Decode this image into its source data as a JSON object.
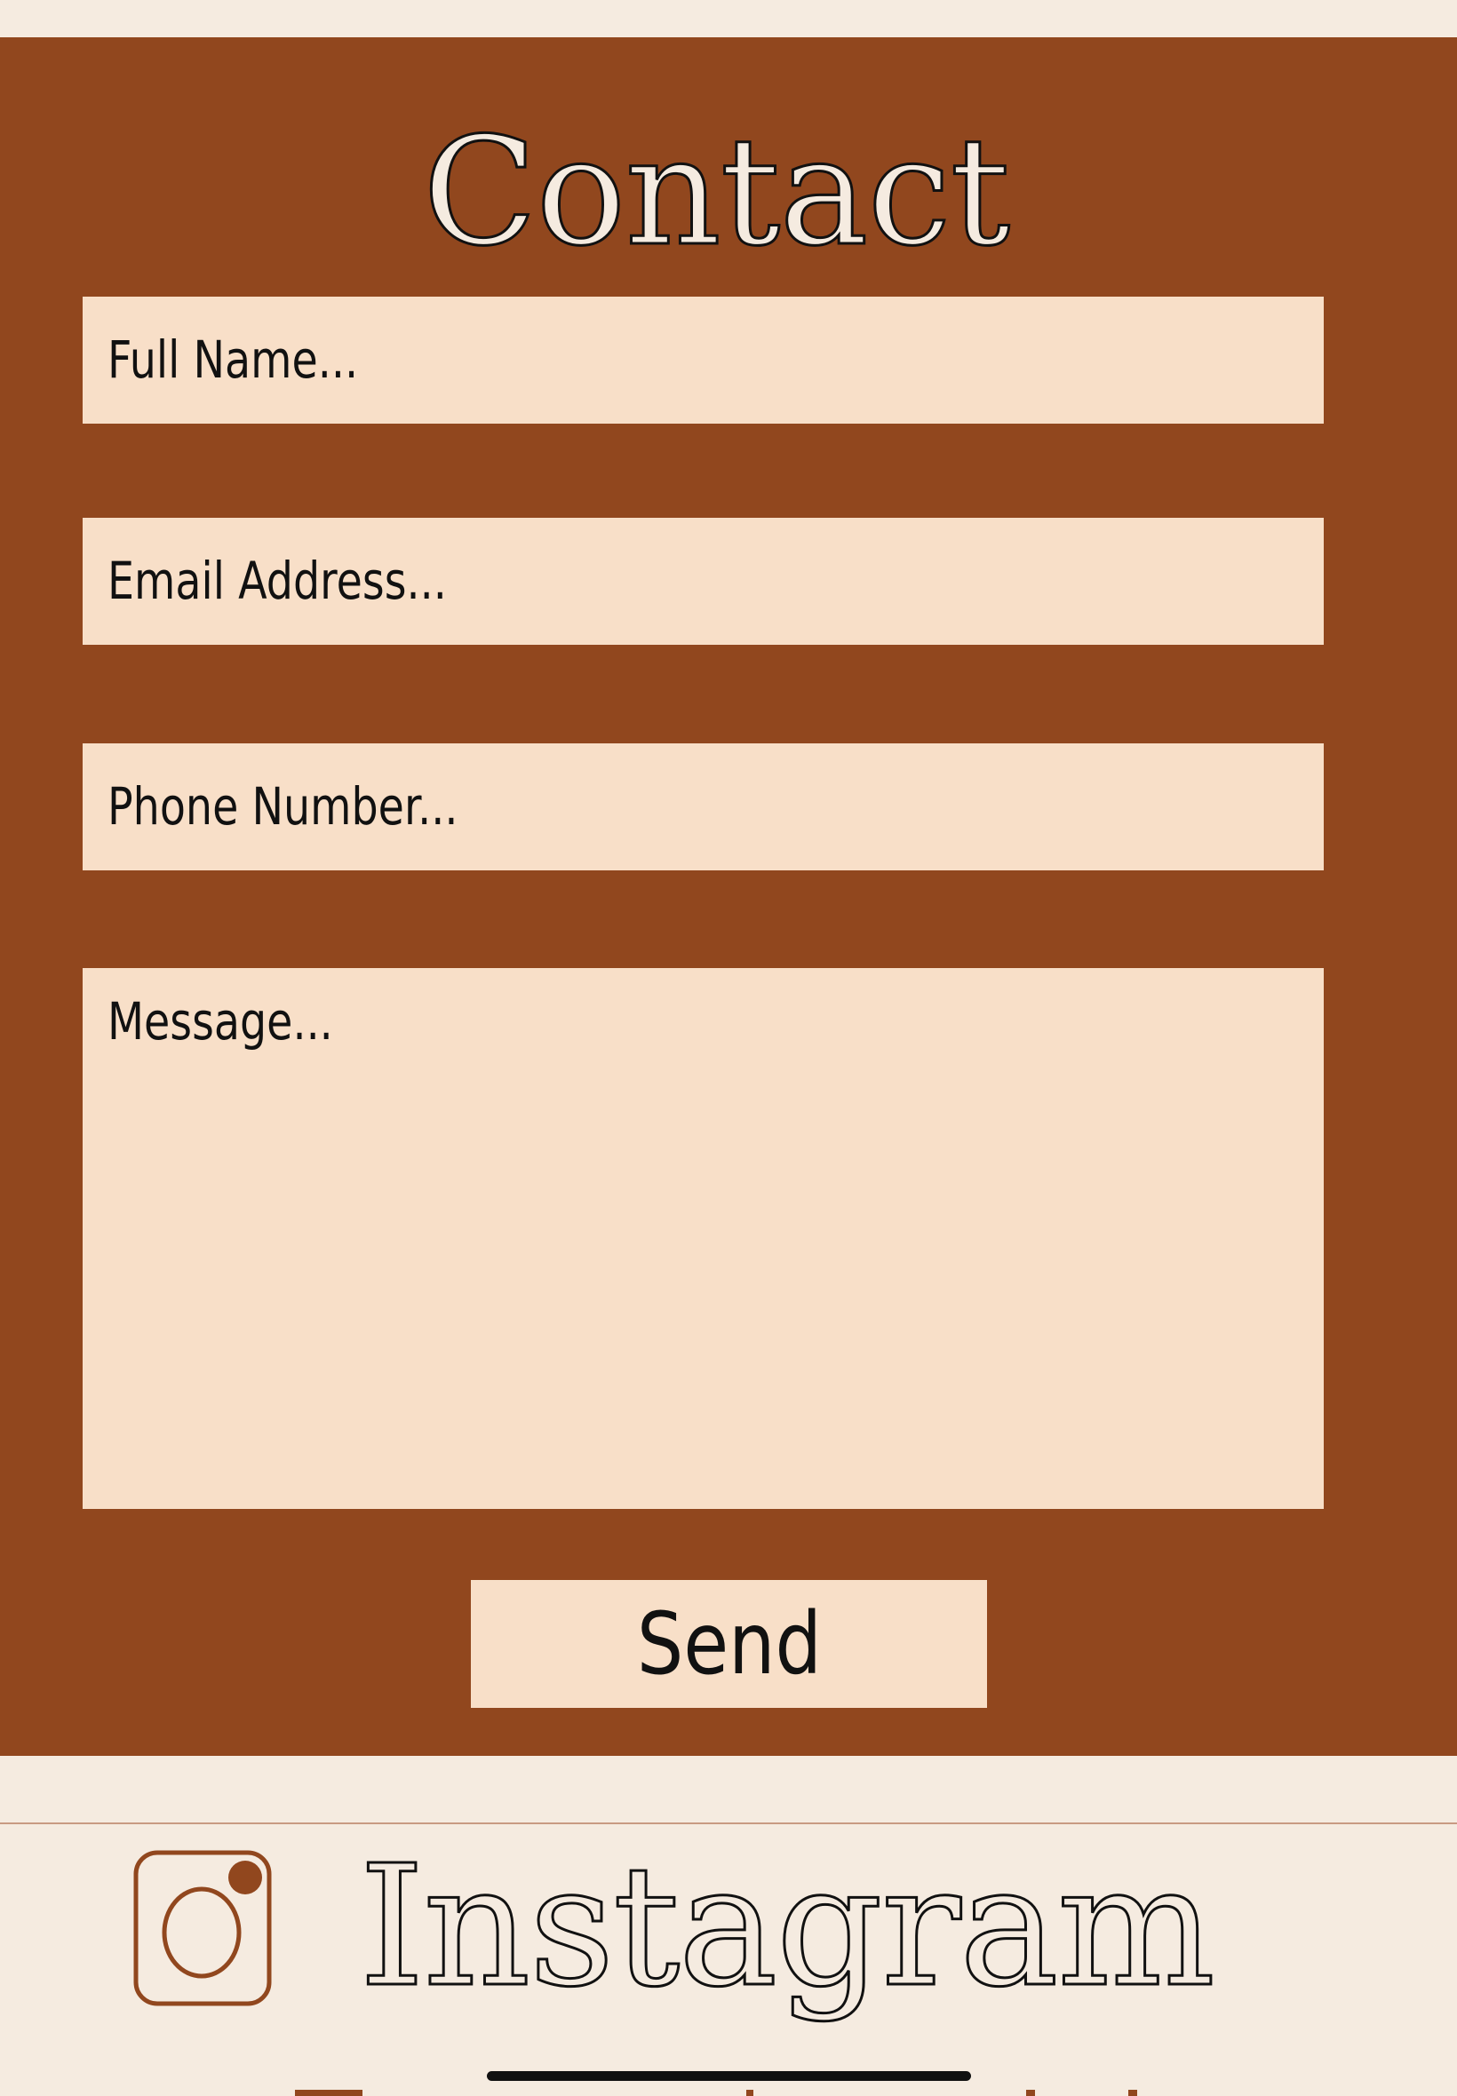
{
  "contact": {
    "title": "Contact",
    "fields": {
      "full_name": {
        "placeholder": "Full Name..."
      },
      "email": {
        "placeholder": "Email Address..."
      },
      "phone": {
        "placeholder": "Phone Number..."
      },
      "message": {
        "placeholder": "Message..."
      }
    },
    "send_label": "Send"
  },
  "social": {
    "instagram_label": "Instagram",
    "icon": "instagram-icon"
  },
  "colors": {
    "accent": "#91471e",
    "page_background": "#f5ebe0",
    "field_background": "#f8dfc8",
    "text": "#111111"
  }
}
